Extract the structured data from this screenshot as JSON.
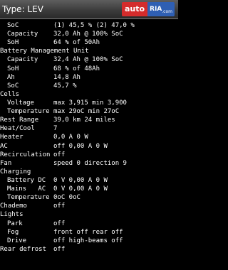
{
  "window": {
    "title": "Type: LEV"
  },
  "logo": {
    "text1": "auto",
    "text2": "RIA",
    "sub": ".com"
  },
  "rows": [
    {
      "label": "SoC",
      "value": "(1) 45,5 % (2) 47,0 %",
      "indent": 1
    },
    {
      "label": "Capacity",
      "value": "32,0 Ah @ 100% SoC",
      "indent": 1
    },
    {
      "label": "SoH",
      "value": "64 % of 50Ah",
      "indent": 1
    },
    {
      "label": "Battery Management Unit",
      "value": "",
      "indent": 0
    },
    {
      "label": "Capacity",
      "value": "32,4 Ah @ 100% SoC",
      "indent": 1
    },
    {
      "label": "SoH",
      "value": "68 % of 48Ah",
      "indent": 1
    },
    {
      "label": "Ah",
      "value": "14,8 Ah",
      "indent": 1
    },
    {
      "label": "SoC",
      "value": "45,7 %",
      "indent": 1
    },
    {
      "label": "Cells",
      "value": "",
      "indent": 0
    },
    {
      "label": "Voltage",
      "value": "max 3,915 min 3,900",
      "indent": 1
    },
    {
      "label": "Temperature",
      "value": "max 29oC min 27oC",
      "indent": 1
    },
    {
      "label": "Rest Range",
      "value": "39,0 km 24 miles",
      "indent": 0
    },
    {
      "label": "Heat/Cool",
      "value": "7",
      "indent": 0
    },
    {
      "label": "Heater",
      "value": "0,0 A 0 W",
      "indent": 0
    },
    {
      "label": "AC",
      "value": "off 0,00 A 0 W",
      "indent": 0
    },
    {
      "label": "Recirculation",
      "value": "off",
      "indent": 0
    },
    {
      "label": "Fan",
      "value": "speed 0 direction 9",
      "indent": 0
    },
    {
      "label": "Charging",
      "value": "",
      "indent": 0
    },
    {
      "label": "Battery DC",
      "value": "0 V 0,00 A 0 W",
      "indent": 1
    },
    {
      "label": "Mains   AC",
      "value": "0 V 0,00 A 0 W",
      "indent": 1
    },
    {
      "label": "Temperature",
      "value": "0oC 0oC",
      "indent": 1
    },
    {
      "label": "Chademo",
      "value": "off",
      "indent": 0
    },
    {
      "label": "Lights",
      "value": "",
      "indent": 0
    },
    {
      "label": "Park",
      "value": "off",
      "indent": 1
    },
    {
      "label": "Fog",
      "value": "front off rear off",
      "indent": 1
    },
    {
      "label": "Drive",
      "value": "off high-beams off",
      "indent": 1
    },
    {
      "label": "Rear defrost",
      "value": "off",
      "indent": 0
    }
  ]
}
